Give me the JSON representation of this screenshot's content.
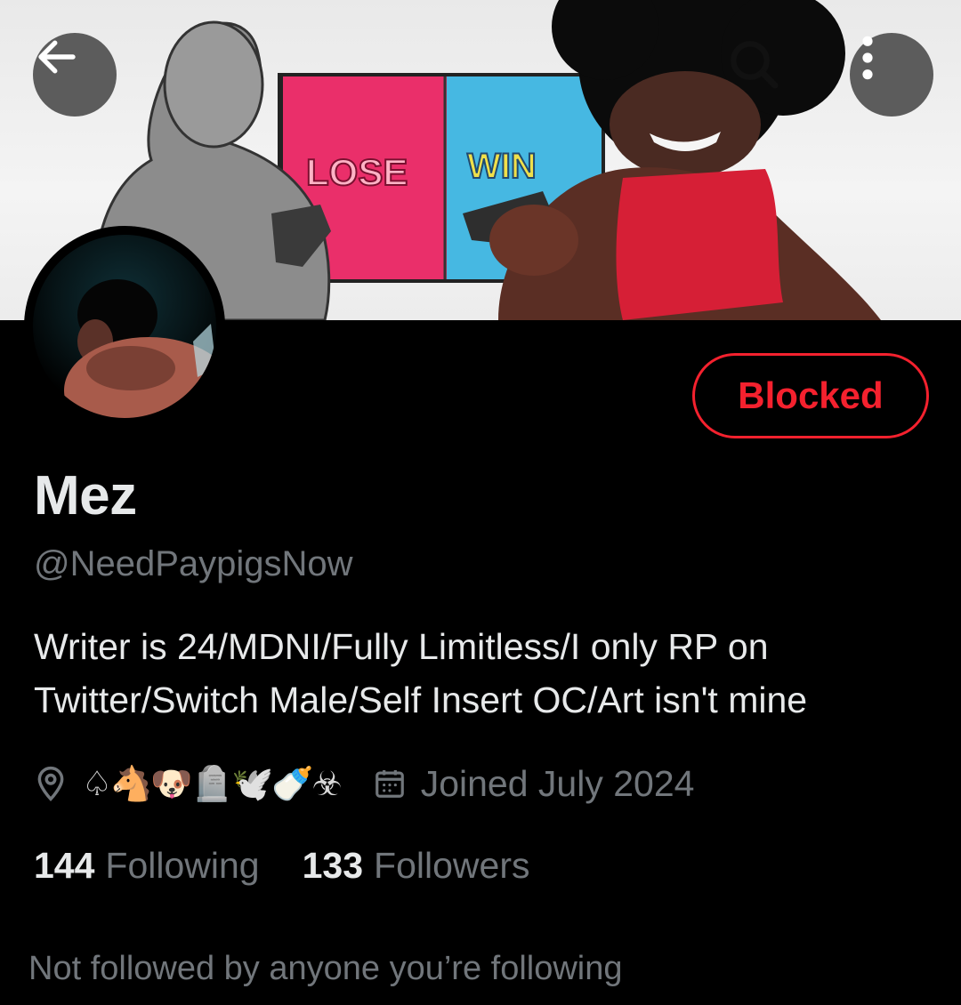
{
  "header": {
    "icons": [
      "back-arrow-icon",
      "search-icon",
      "more-vertical-icon"
    ]
  },
  "banner": {
    "lose_text": "LOSE",
    "win_text": "WIN",
    "colors": {
      "lose_panel": "#ea2f6a",
      "win_panel": "#46b8e2",
      "figure_red": "#d61f36"
    }
  },
  "profile": {
    "action_button": "Blocked",
    "name": "Mez",
    "handle": "@NeedPaypigsNow",
    "bio": "Writer is 24/MDNI/Fully Limitless/I only RP on Twitter/Switch Male/Self Insert OC/Art isn't mine",
    "location": "♤🐴🐶🪦🕊️🍼☣",
    "joined": "Joined July 2024",
    "following_count": "144",
    "following_label": "Following",
    "followers_count": "133",
    "followers_label": "Followers",
    "mutuals_note": "Not followed by anyone you’re following"
  },
  "colors": {
    "accent_red": "#f4212e",
    "text_primary": "#e7e9ea",
    "text_secondary": "#71767b",
    "background": "#000000"
  }
}
